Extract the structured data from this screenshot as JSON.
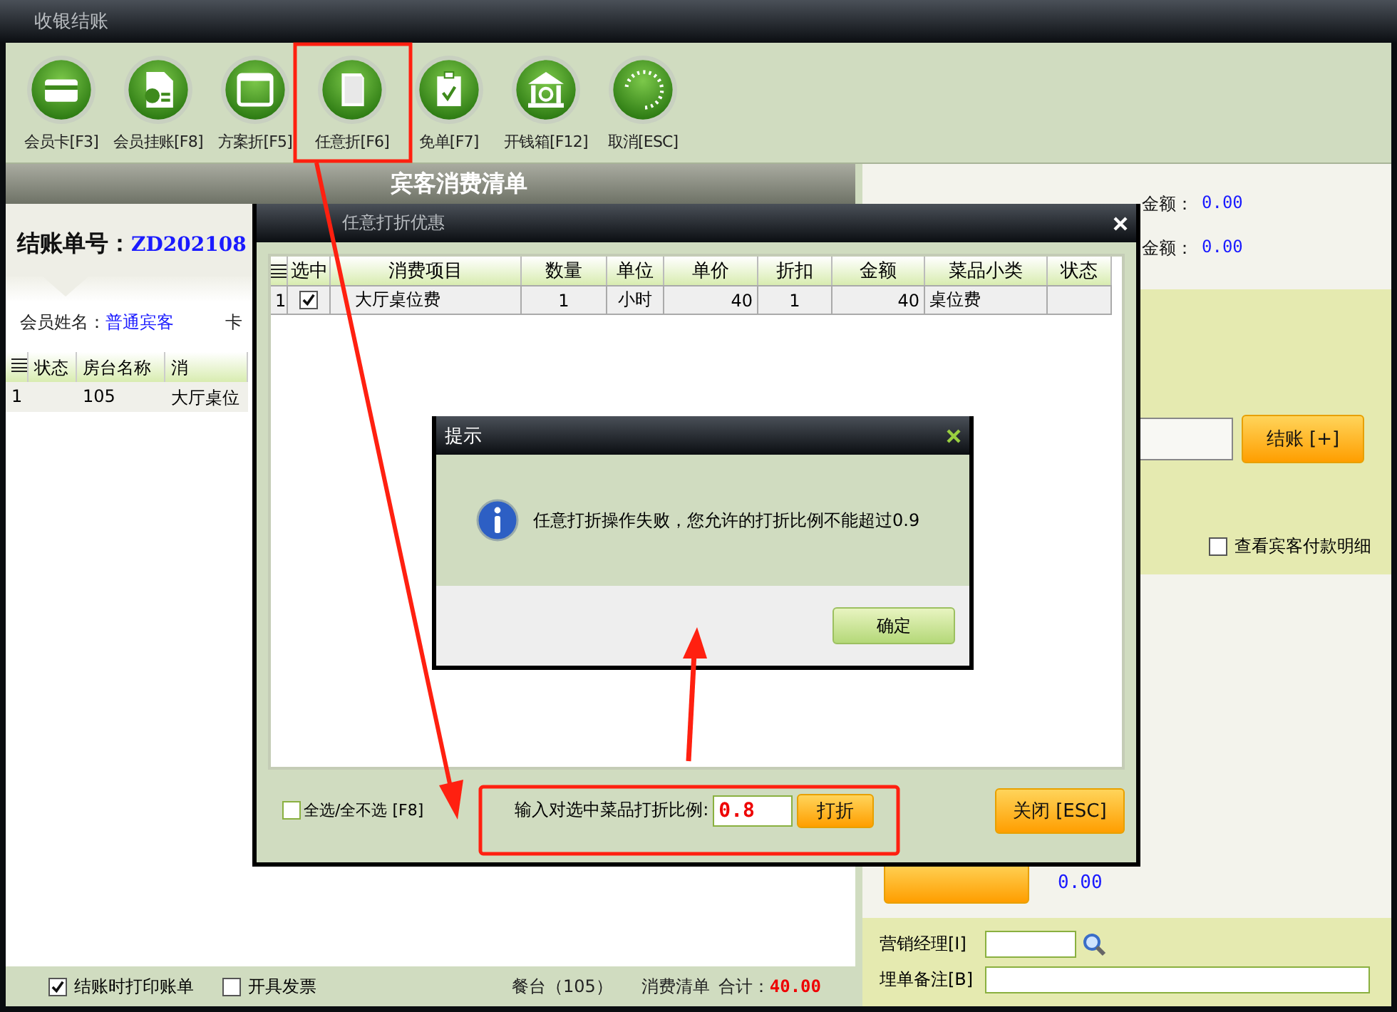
{
  "window": {
    "title": "收银结账"
  },
  "toolbar": [
    {
      "label": "会员卡[F3]",
      "kind": "card"
    },
    {
      "label": "会员挂账[F8]",
      "kind": "document"
    },
    {
      "label": "方案折[F5]",
      "kind": "window"
    },
    {
      "label": "任意折[F6]",
      "kind": "cards"
    },
    {
      "label": "免单[F7]",
      "kind": "clipboard"
    },
    {
      "label": "开钱箱[F12]",
      "kind": "bank"
    },
    {
      "label": "取消[ESC]",
      "kind": "dots"
    }
  ],
  "bill_panel": {
    "header": "宾客消费清单",
    "bill_no_label": "结账单号：",
    "bill_no": "ZD202108",
    "member_label": "会员姓名：",
    "member_name": "普通宾客",
    "card_label": "卡",
    "columns": [
      "状态",
      "房台名称",
      "消"
    ],
    "rows": [
      {
        "number": "1",
        "room": "105",
        "item": "大厅桌位"
      }
    ]
  },
  "footer": {
    "options": [
      {
        "label": "结账时打印账单",
        "checked": true
      },
      {
        "label": "开具发票",
        "checked": false
      }
    ],
    "table_info": "餐台（105）",
    "list_label": "消费清单",
    "total_label": "合计：",
    "total": "40.00"
  },
  "summary": {
    "rows": [
      {
        "label": "金额：",
        "value": "0.00"
      },
      {
        "label": "金额：",
        "value": "0.00"
      }
    ],
    "checkout_button": "结账 [+]",
    "detail_option": {
      "label": "查看宾客付款明细",
      "checked": false
    },
    "change_value": "0.00",
    "manager_label": "营销经理[I]",
    "note_label": "埋单备注[B]"
  },
  "discount_dialog": {
    "title": "任意打折优惠",
    "columns": [
      "选中",
      "消费项目",
      "数量",
      "单位",
      "单价",
      "折扣",
      "金额",
      "菜品小类",
      "状态"
    ],
    "rows": [
      {
        "number": "1",
        "checked": true,
        "item": "大厅桌位费",
        "qty": "1",
        "unit": "小时",
        "price": "40",
        "discount": "1",
        "amount": "40",
        "category": "桌位费"
      }
    ],
    "select_all": {
      "label": "全选/全不选 [F8]",
      "checked": false
    },
    "ratio_label": "输入对选中菜品打折比例:",
    "ratio_value": "0.8",
    "apply_button": "打折",
    "close_button": "关闭 [ESC]"
  },
  "message_box": {
    "title": "提示",
    "message": "任意打折操作失败，您允许的打折比例不能超过0.9",
    "ok_button": "确定"
  }
}
